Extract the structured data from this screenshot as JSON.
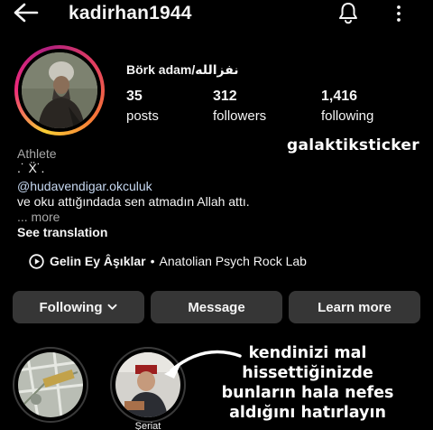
{
  "header": {
    "username": "kadirhan1944",
    "icons": {
      "back": "arrow-left-icon",
      "notifications": "bell-icon",
      "menu": "more-vertical-icon"
    }
  },
  "profile": {
    "display_name": "Börk adam/نفزالله",
    "stats": [
      {
        "value": "35",
        "label": "posts"
      },
      {
        "value": "312",
        "label": "followers"
      },
      {
        "value": "1,416",
        "label": "following"
      }
    ],
    "category": "Athlete",
    "bio_decoration": ".˙ Ẍ˙.",
    "mention": "@hudavendigar.okculuk",
    "bio_text": "ve oku attığındada sen atmadın Allah attı.",
    "more": "... more",
    "see_translation": "See translation"
  },
  "music": {
    "song": "Gelin Ey Âşıklar",
    "separator": "•",
    "artist": "Anatolian Psych Rock Lab"
  },
  "actions": {
    "following": "Following",
    "message": "Message",
    "learn_more": "Learn more"
  },
  "highlights": [
    {
      "label": ""
    },
    {
      "label": "Şeriat"
    }
  ],
  "overlay": {
    "sticker": "galaktiksticker",
    "caption_lines": [
      "kendinizi mal",
      "hissettiğinizde",
      "bunların hala nefes",
      "aldığını hatırlayın"
    ]
  },
  "colors": {
    "background": "#000000",
    "button": "#363636",
    "mention": "#c7d9f2",
    "secondary_text": "#a8a8a8"
  }
}
